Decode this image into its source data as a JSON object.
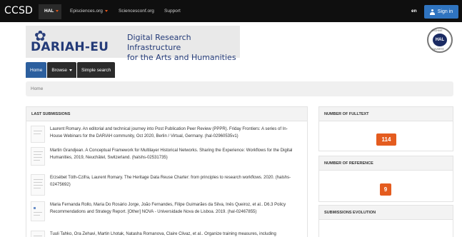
{
  "topbar": {
    "brand": "CCSD",
    "nav": [
      {
        "label": "HAL"
      },
      {
        "label": "Episciences.org"
      },
      {
        "label": "Sciencesconf.org"
      },
      {
        "label": "Support"
      }
    ],
    "lang": "en",
    "signin_label": "Sign in"
  },
  "banner": {
    "brand": "DARIAH-EU",
    "line1": "Digital Research Infrastructure",
    "line2": "for the Arts and Humanities"
  },
  "seal": {
    "center": "HAL",
    "top": "ARCHIVE",
    "bottom": "OUVERTE"
  },
  "menu": [
    {
      "label": "Home"
    },
    {
      "label": "Browse"
    },
    {
      "label": "Simple search"
    }
  ],
  "breadcrumb": "Home",
  "last_submissions": {
    "title": "LAST SUBMISSIONS",
    "items": [
      {
        "text": "Laurent Romary. An editorial and technical journey into Post Publication Peer Review (PPPR). Friday Frontiers: A series of In-House Webinars for the DARIAH community, Oct 2020, Berlin / Virtual, Germany. (hal-02960535v1)"
      },
      {
        "text": "Martin Grandjean. A Conceptual Framework for Multilayer Historical Networks. Sharing the Experience: Workflows for the Digital Humanities, 2019, Neuchâtel, Switzerland. (halshs-02531735)"
      },
      {
        "text": "Erzsébet Tóth-Czifra, Laurent Romary. The Heritage Data Reuse Charter: from principles to research workflows. 2020. (halshs-02475692)"
      },
      {
        "text": "Maria Fernanda Rollo, Maria Do Rosário Jorge, João Fernandes, Filipe Guimarães da Silva, Inês Queiroz, et al.. D6.3 Policy Recommendations and Strategy Report. [Other] NOVA - Universidade Nova de Lisboa. 2019. (hal-02467855)"
      },
      {
        "text": "Tuuli Tahko, Ora Zehavi, Martin Lhotak, Natasha Romanova, Claire Clivaz, et al.. Organize training measures, including"
      }
    ]
  },
  "fulltext": {
    "title": "NUMBER OF FULLTEXT",
    "value": "114"
  },
  "reference": {
    "title": "NUMBER OF REFERENCE",
    "value": "9"
  },
  "evolution": {
    "title": "SUBMISSIONS EVOLUTION"
  },
  "colors": {
    "topbar": "#0f0f0f",
    "accent": "#2c5f9e",
    "badge": "#e45c1f",
    "brand": "#233a78"
  }
}
